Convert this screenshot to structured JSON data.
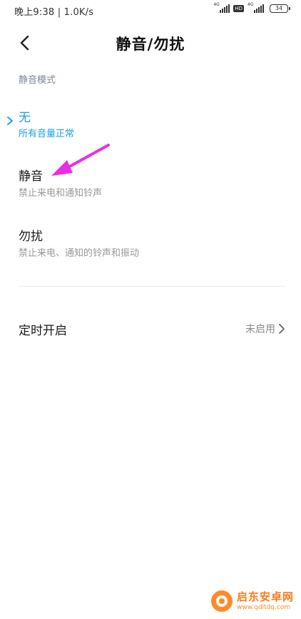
{
  "status_bar": {
    "time_speed": "晚上9:38 | 1.0K/s",
    "sim1_tag": "4G",
    "hd_label": "HD",
    "sim2_tag": "4G",
    "battery": "34"
  },
  "header": {
    "title": "静音/勿扰"
  },
  "section": {
    "label": "静音模式"
  },
  "options": [
    {
      "title": "无",
      "desc": "所有音量正常"
    },
    {
      "title": "静音",
      "desc": "禁止来电和通知铃声"
    },
    {
      "title": "勿扰",
      "desc": "禁止来电、通知的铃声和振动"
    }
  ],
  "schedule": {
    "label": "定时开启",
    "value": "未启用"
  },
  "colors": {
    "accent": "#1aa1e8",
    "annotation_arrow": "#e62fe6",
    "watermark": "#ff7a1a"
  },
  "watermark": {
    "name": "启东安卓网",
    "url": "www.qdltdq.com"
  }
}
